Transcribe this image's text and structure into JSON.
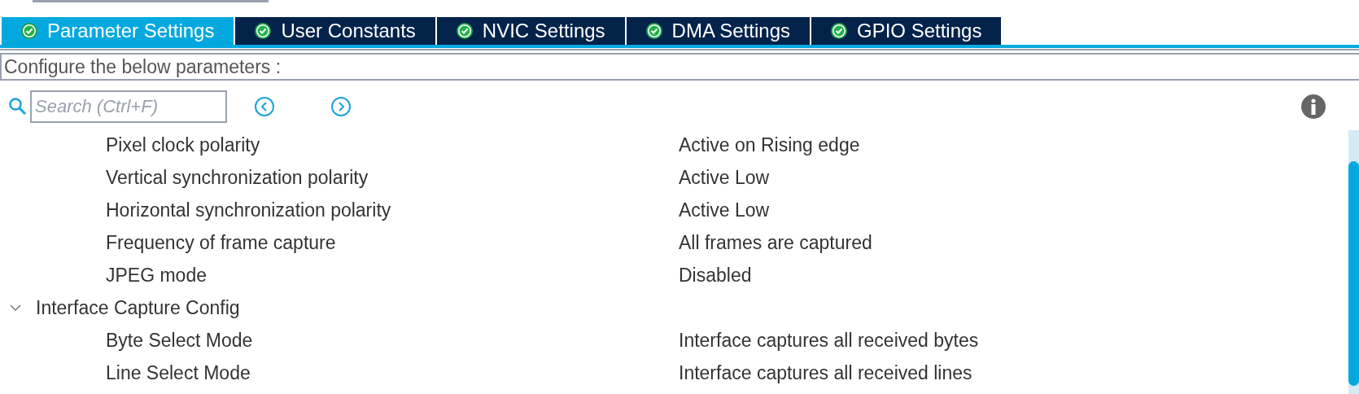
{
  "tabs": [
    {
      "label": "Parameter Settings",
      "selected": true
    },
    {
      "label": "User Constants",
      "selected": false
    },
    {
      "label": "NVIC Settings",
      "selected": false
    },
    {
      "label": "DMA Settings",
      "selected": false
    },
    {
      "label": "GPIO Settings",
      "selected": false
    }
  ],
  "header": "Configure the below parameters :",
  "search": {
    "placeholder": "Search (Ctrl+F)"
  },
  "rows": [
    {
      "kind": "param",
      "label": "Pixel clock polarity",
      "value": "Active on Rising edge"
    },
    {
      "kind": "param",
      "label": "Vertical synchronization polarity",
      "value": "Active Low"
    },
    {
      "kind": "param",
      "label": "Horizontal synchronization polarity",
      "value": "Active Low"
    },
    {
      "kind": "param",
      "label": "Frequency of frame capture",
      "value": "All frames are captured"
    },
    {
      "kind": "param",
      "label": "JPEG mode",
      "value": "Disabled"
    },
    {
      "kind": "group",
      "label": "Interface Capture Config",
      "expanded": true,
      "children": [
        {
          "kind": "param",
          "label": "Byte Select Mode",
          "value": "Interface captures all received bytes"
        },
        {
          "kind": "param",
          "label": "Line Select Mode",
          "value": "Interface captures all received lines"
        }
      ]
    }
  ]
}
